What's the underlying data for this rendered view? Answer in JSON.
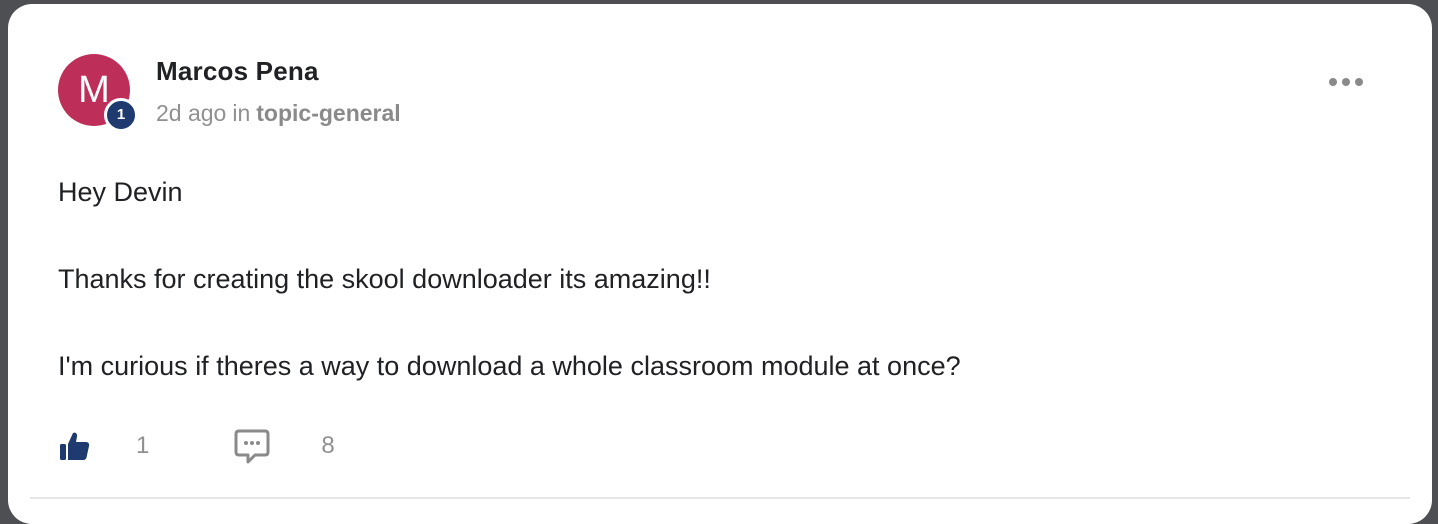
{
  "post": {
    "author": {
      "name": "Marcos Pena",
      "initial": "M",
      "level": "1",
      "avatar_color": "#bd2f59",
      "badge_color": "#1e3a6e"
    },
    "meta": {
      "time": "2d ago",
      "in_word": "in",
      "topic": "topic-general"
    },
    "body": {
      "paragraphs": [
        "Hey Devin",
        "Thanks for creating the skool downloader its amazing!!",
        "I'm curious if theres a way to download a whole classroom module at once?"
      ]
    },
    "actions": {
      "like_count": "1",
      "comment_count": "8",
      "like_icon": "thumbs-up-icon",
      "comment_icon": "comment-icon",
      "more_icon": "more-horizontal-icon",
      "accent_color": "#1e3a6e"
    }
  }
}
